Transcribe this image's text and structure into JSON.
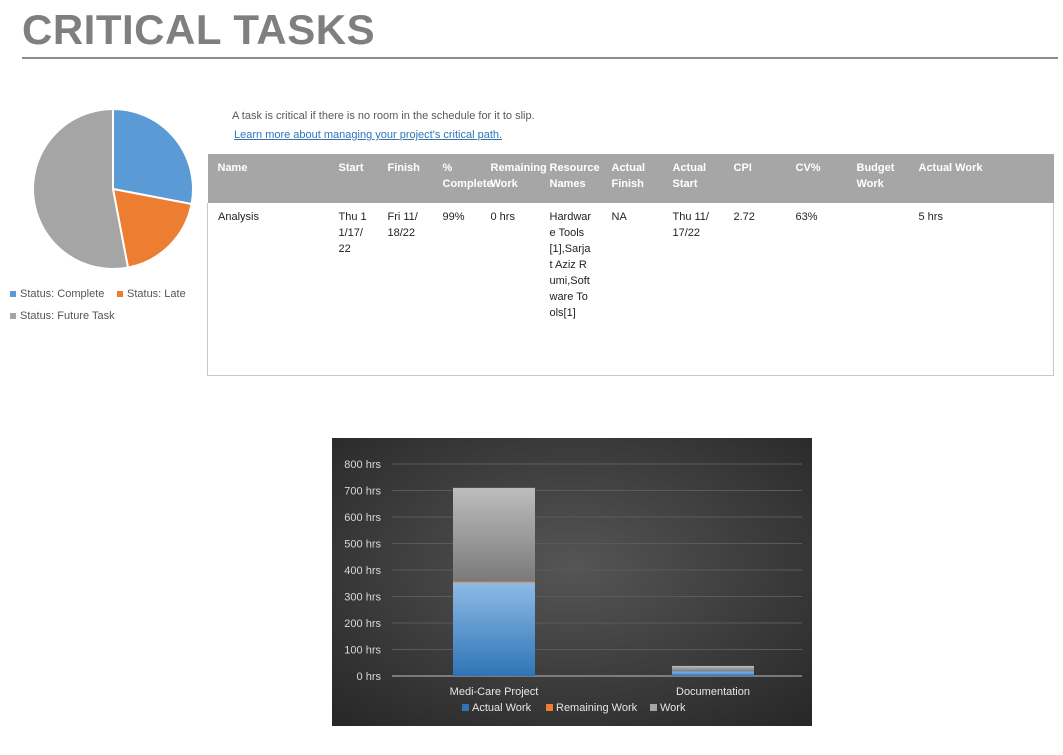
{
  "page": {
    "title": "CRITICAL TASKS",
    "description": "A task is critical if there is no room in the schedule for it to slip.",
    "link_text": "Learn more about managing your project's critical path."
  },
  "colors": {
    "title": "#7f7f7f",
    "table_header_bg": "#a6a6a6",
    "link": "#2e75b6",
    "complete": "#5b9bd5",
    "late": "#ed7d31",
    "future": "#a5a5a5",
    "chart_bg": "#3a3a3a"
  },
  "table": {
    "columns": [
      "Name",
      "Start",
      "Finish",
      "% Complete",
      "Remaining Work",
      "Resource Names",
      "Actual Finish",
      "Actual Start",
      "CPI",
      "CV%",
      "Budget Work",
      "Actual Work"
    ],
    "rows": [
      [
        "Analysis",
        "Thu 11/17/22",
        "Fri 11/18/22",
        "99%",
        "0 hrs",
        "Hardware Tools[1],Sarjat Aziz Rumi,Software Tools[1]",
        "NA",
        "Thu 11/17/22",
        "2.72",
        "63%",
        "",
        "5 hrs"
      ]
    ]
  },
  "chart_data": [
    {
      "type": "pie",
      "slices": [
        {
          "label": "Status: Complete",
          "value": 28,
          "color": "#5b9bd5"
        },
        {
          "label": "Status: Late",
          "value": 19,
          "color": "#ed7d31"
        },
        {
          "label": "Status: Future Task",
          "value": 53,
          "color": "#a5a5a5"
        }
      ],
      "legend": "bottom"
    },
    {
      "type": "bar",
      "stacked": true,
      "categories": [
        "Medi-Care Project",
        "Documentation"
      ],
      "series": [
        {
          "name": "Actual Work",
          "values": [
            355,
            18
          ],
          "color": "#2e75b6"
        },
        {
          "name": "Remaining Work",
          "values": [
            2,
            0
          ],
          "color": "#ed7d31"
        },
        {
          "name": "Work",
          "values": [
            353,
            20
          ],
          "color": "#a5a5a5"
        }
      ],
      "yticks": [
        "0 hrs",
        "100 hrs",
        "200 hrs",
        "300 hrs",
        "400 hrs",
        "500 hrs",
        "600 hrs",
        "700 hrs",
        "800 hrs"
      ],
      "ylim": [
        0,
        800
      ],
      "grid": true,
      "legend": "bottom"
    }
  ]
}
